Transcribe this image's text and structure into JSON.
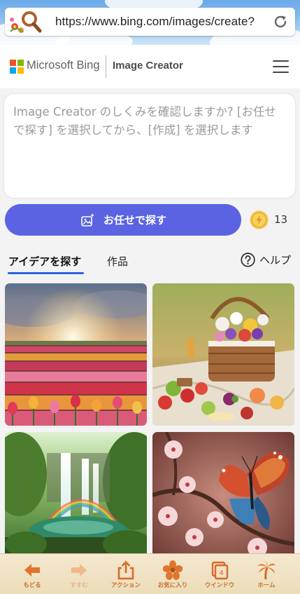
{
  "browser": {
    "url": "https://www.bing.com/images/create?"
  },
  "header": {
    "brand": "Microsoft Bing",
    "product": "Image Creator",
    "logo_colors": [
      "#f25022",
      "#7fba00",
      "#00a4ef",
      "#ffb900"
    ]
  },
  "prompt": {
    "placeholder": "Image Creator のしくみを確認しますか? [お任せで探す] を選択してから、[作成] を選択します"
  },
  "surprise": {
    "label": "お任せで探す",
    "color": "#5b63e3"
  },
  "boosts": {
    "count": "13"
  },
  "tabs": [
    {
      "label": "アイデアを探す",
      "active": true
    },
    {
      "label": "作品",
      "active": false
    }
  ],
  "help": {
    "label": "ヘルプ"
  },
  "gallery": [
    {
      "subject": "tulip field at sunset"
    },
    {
      "subject": "picnic basket with fruit and flowers"
    },
    {
      "subject": "waterfall with rainbow in jungle"
    },
    {
      "subject": "butterfly on cherry blossoms"
    }
  ],
  "toolbar": {
    "items": [
      {
        "label": "もどる",
        "icon": "back-arrow-icon",
        "enabled": true
      },
      {
        "label": "すすむ",
        "icon": "forward-arrow-icon",
        "enabled": false
      },
      {
        "label": "アクション",
        "icon": "share-icon",
        "enabled": true
      },
      {
        "label": "お気に入り",
        "icon": "hibiscus-icon",
        "enabled": true
      },
      {
        "label": "ウインドウ",
        "icon": "windows-icon",
        "enabled": true,
        "badge": "4"
      },
      {
        "label": "ホーム",
        "icon": "palm-tree-icon",
        "enabled": true
      }
    ],
    "accent": "#c8702a"
  }
}
